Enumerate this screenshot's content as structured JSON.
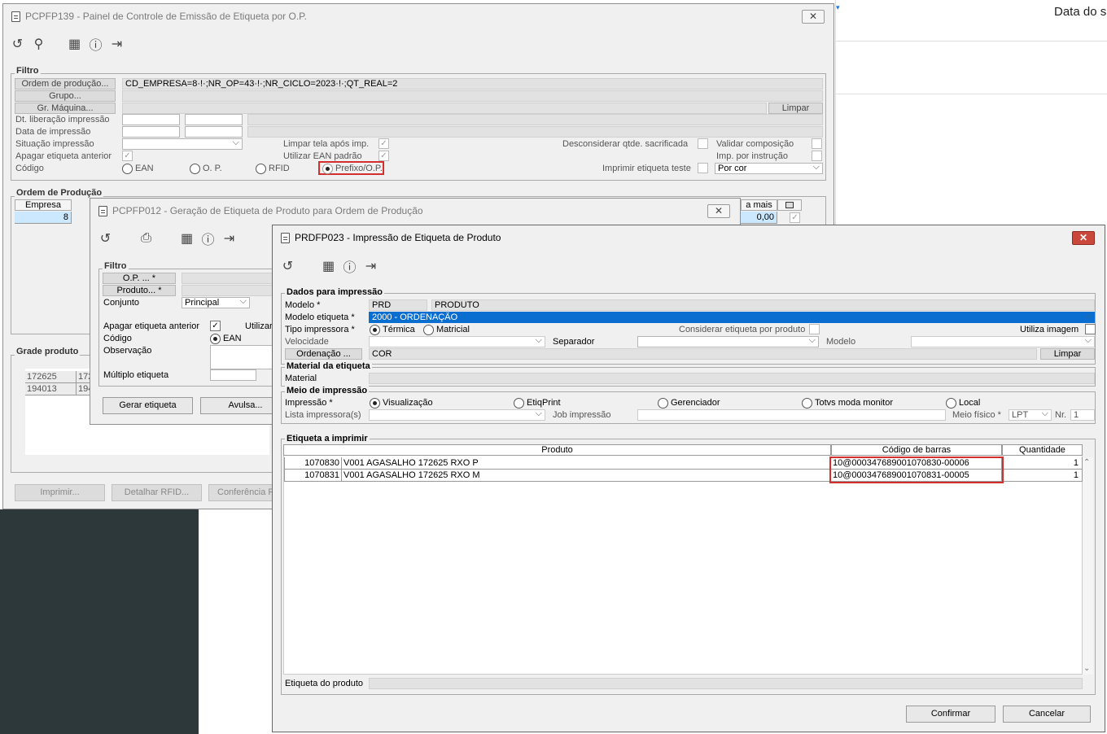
{
  "background": {
    "top_right_text": "Data do s"
  },
  "pcpfp139": {
    "title": "PCPFP139 - Painel de Controle de Emissão de Etiqueta por O.P.",
    "close_label": "✕",
    "filtro_title": "Filtro",
    "btn_ordem": "Ordem de produção...",
    "btn_grupo": "Grupo...",
    "btn_gr_maquina": "Gr. Máquina...",
    "filter_value": "CD_EMPRESA=8·!·;NR_OP=43·!·;NR_CICLO=2023·!·;QT_REAL=2",
    "btn_limpar": "Limpar",
    "lbl_dt_liberacao": "Dt. liberação impressão",
    "lbl_data_impressao": "Data de impressão",
    "lbl_situacao": "Situação impressão",
    "lbl_apagar": "Apagar etiqueta anterior",
    "lbl_codigo": "Código",
    "opt_ean": "EAN",
    "opt_op": "O. P.",
    "opt_rfid": "RFID",
    "opt_prefixo": "Prefixo/O.P.",
    "lbl_limpar_tela": "Limpar tela após imp.",
    "lbl_utilizar_ean": "Utilizar EAN padrão",
    "lbl_desconsiderar": "Desconsiderar qtde. sacrificada",
    "lbl_validar": "Validar composição",
    "lbl_imp_instrucao": "Imp. por instrução",
    "lbl_imprimir_teste": "Imprimir etiqueta teste",
    "por_cor": "Por cor",
    "ordem_title": "Ordem de Produção",
    "col_empresa": "Empresa",
    "row_empresa": "8",
    "col_a_mais": "a mais",
    "row_a_mais": "0,00",
    "grade_title": "Grade produto",
    "grade_rows": [
      "172625",
      "194013"
    ],
    "grade_rows2": [
      "172",
      "194"
    ],
    "btn_imprimir": "Imprimir...",
    "btn_detalhar": "Detalhar RFID...",
    "btn_conferencia": "Conferência R"
  },
  "pcpfp012": {
    "title": "PCPFP012 - Geração de Etiqueta de Produto para Ordem de Produção",
    "close_label": "✕",
    "filtro_title": "Filtro",
    "btn_op": "O.P. ... *",
    "btn_produto": "Produto... *",
    "lbl_conjunto": "Conjunto",
    "conjunto_value": "Principal",
    "lbl_apagar": "Apagar etiqueta anterior",
    "lbl_utilizar": "Utilizar",
    "lbl_codigo": "Código",
    "opt_ean": "EAN",
    "lbl_observacao": "Observação",
    "lbl_multiplo": "Múltiplo etiqueta",
    "btn_gerar": "Gerar etiqueta",
    "btn_avulsa": "Avulsa..."
  },
  "prdfp023": {
    "title": "PRDFP023 - Impressão de Etiqueta de Produto",
    "close_label": "✕",
    "dados_title": "Dados para impressão",
    "lbl_modelo": "Modelo *",
    "modelo_code": "PRD",
    "modelo_desc": "PRODUTO",
    "lbl_modelo_etiqueta": "Modelo etiqueta *",
    "modelo_etiqueta_value": "2000 - ORDENAÇÃO",
    "lbl_tipo_impressora": "Tipo impressora *",
    "opt_termica": "Térmica",
    "opt_matricial": "Matricial",
    "lbl_considerar": "Considerar etiqueta por produto",
    "lbl_utiliza_imagem": "Utiliza imagem",
    "lbl_velocidade": "Velocidade",
    "lbl_separador": "Separador",
    "lbl_modelo2": "Modelo",
    "btn_ordenacao": "Ordenação ...",
    "ordenacao_value": "COR",
    "btn_limpar": "Limpar",
    "material_title": "Material da etiqueta",
    "lbl_material": "Material",
    "meio_title": "Meio de impressão",
    "lbl_impressao": "Impressão *",
    "opt_visualizacao": "Visualização",
    "opt_etiqprint": "EtiqPrint",
    "opt_gerenciador": "Gerenciador",
    "opt_totvs": "Totvs moda monitor",
    "opt_local": "Local",
    "lbl_lista_impressoras": "Lista impressora(s)",
    "lbl_job": "Job impressão",
    "lbl_meio_fisico": "Meio físico *",
    "meio_fisico_value": "LPT",
    "lbl_nr": "Nr.",
    "nr_value": "1",
    "etiqueta_title": "Etiqueta a imprimir",
    "col_produto": "Produto",
    "col_codigo_barras": "Código de barras",
    "col_quantidade": "Quantidade",
    "rows": [
      {
        "codigo": "1070830",
        "descricao": "V001 AGASALHO 172625 RXO P",
        "barras": "10@000347689001070830-00006",
        "quantidade": "1"
      },
      {
        "codigo": "1070831",
        "descricao": "V001 AGASALHO 172625 RXO M",
        "barras": "10@000347689001070831-00005",
        "quantidade": "1"
      }
    ],
    "lbl_etiqueta_produto": "Etiqueta do produto",
    "btn_confirmar": "Confirmar",
    "btn_cancelar": "Cancelar"
  },
  "icons": [
    "undo-icon",
    "search-icon",
    "calendar-icon",
    "help-icon",
    "exit-icon",
    "print-icon"
  ],
  "colors": {
    "selection": "#0a6ed1",
    "highlight_box": "#d32f2f",
    "close_red": "#c9483b"
  }
}
